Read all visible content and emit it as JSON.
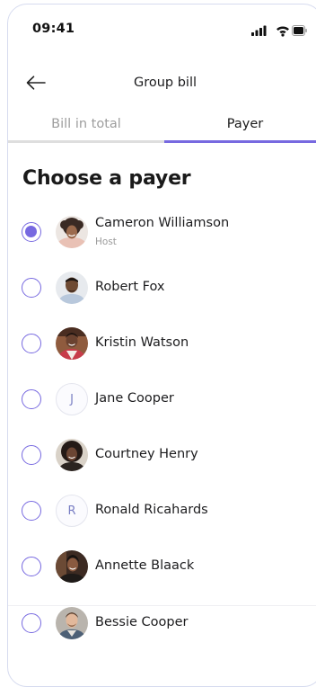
{
  "status_bar": {
    "time": "09:41",
    "icons": [
      "signal-icon",
      "wifi-icon",
      "battery-icon"
    ]
  },
  "header": {
    "back_icon": "arrow-left-icon",
    "title": "Group bill"
  },
  "tabs": [
    {
      "label": "Bill in total",
      "active": false
    },
    {
      "label": "Payer",
      "active": true
    }
  ],
  "section_title": "Choose a payer",
  "colors": {
    "accent": "#7769e0",
    "tab_inactive_underline": "#dedede",
    "text_primary": "#1c1c1e",
    "text_secondary": "#9b9b9b"
  },
  "payers": [
    {
      "name": "Cameron Williamson",
      "subtitle": "Host",
      "selected": true,
      "avatar": "photo"
    },
    {
      "name": "Robert Fox",
      "selected": false,
      "avatar": "photo"
    },
    {
      "name": "Kristin Watson",
      "selected": false,
      "avatar": "photo"
    },
    {
      "name": "Jane Cooper",
      "selected": false,
      "avatar": "initial",
      "initial": "J"
    },
    {
      "name": "Courtney Henry",
      "selected": false,
      "avatar": "photo"
    },
    {
      "name": "Ronald Ricahards",
      "selected": false,
      "avatar": "initial",
      "initial": "R"
    },
    {
      "name": "Annette Blaack",
      "selected": false,
      "avatar": "photo"
    },
    {
      "name": "Bessie Cooper",
      "selected": false,
      "avatar": "photo"
    }
  ]
}
